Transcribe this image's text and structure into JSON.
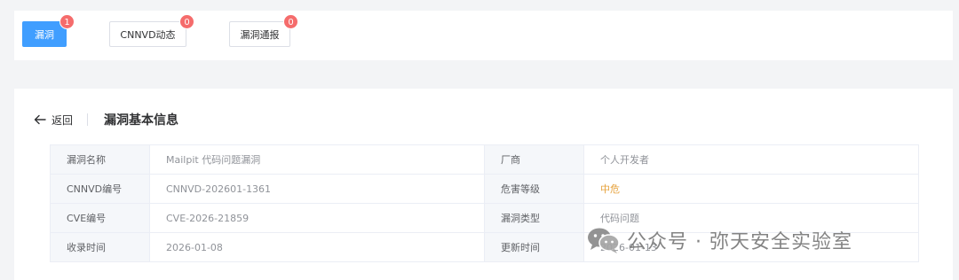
{
  "tabs": [
    {
      "label": "漏洞",
      "badge": "1",
      "active": true
    },
    {
      "label": "CNNVD动态",
      "badge": "0",
      "active": false
    },
    {
      "label": "漏洞通报",
      "badge": "0",
      "active": false
    }
  ],
  "detail": {
    "back_label": "返回",
    "title": "漏洞基本信息",
    "rows": [
      {
        "label_left": "漏洞名称",
        "value_left": "Mailpit 代码问题漏洞",
        "label_right": "厂商",
        "value_right": "个人开发者"
      },
      {
        "label_left": "CNNVD编号",
        "value_left": "CNNVD-202601-1361",
        "label_right": "危害等级",
        "value_right": "中危"
      },
      {
        "label_left": "CVE编号",
        "value_left": "CVE-2026-21859",
        "label_right": "漏洞类型",
        "value_right": "代码问题"
      },
      {
        "label_left": "收录时间",
        "value_left": "2026-01-08",
        "label_right": "更新时间",
        "value_right": "2026-01-13"
      }
    ]
  },
  "colors": {
    "accent": "#409eff",
    "badge": "#f56c6c",
    "severity_medium": "#e6a23c"
  },
  "watermark": {
    "icon": "wechat-icon",
    "text": "公众号 · 弥天安全实验室"
  }
}
